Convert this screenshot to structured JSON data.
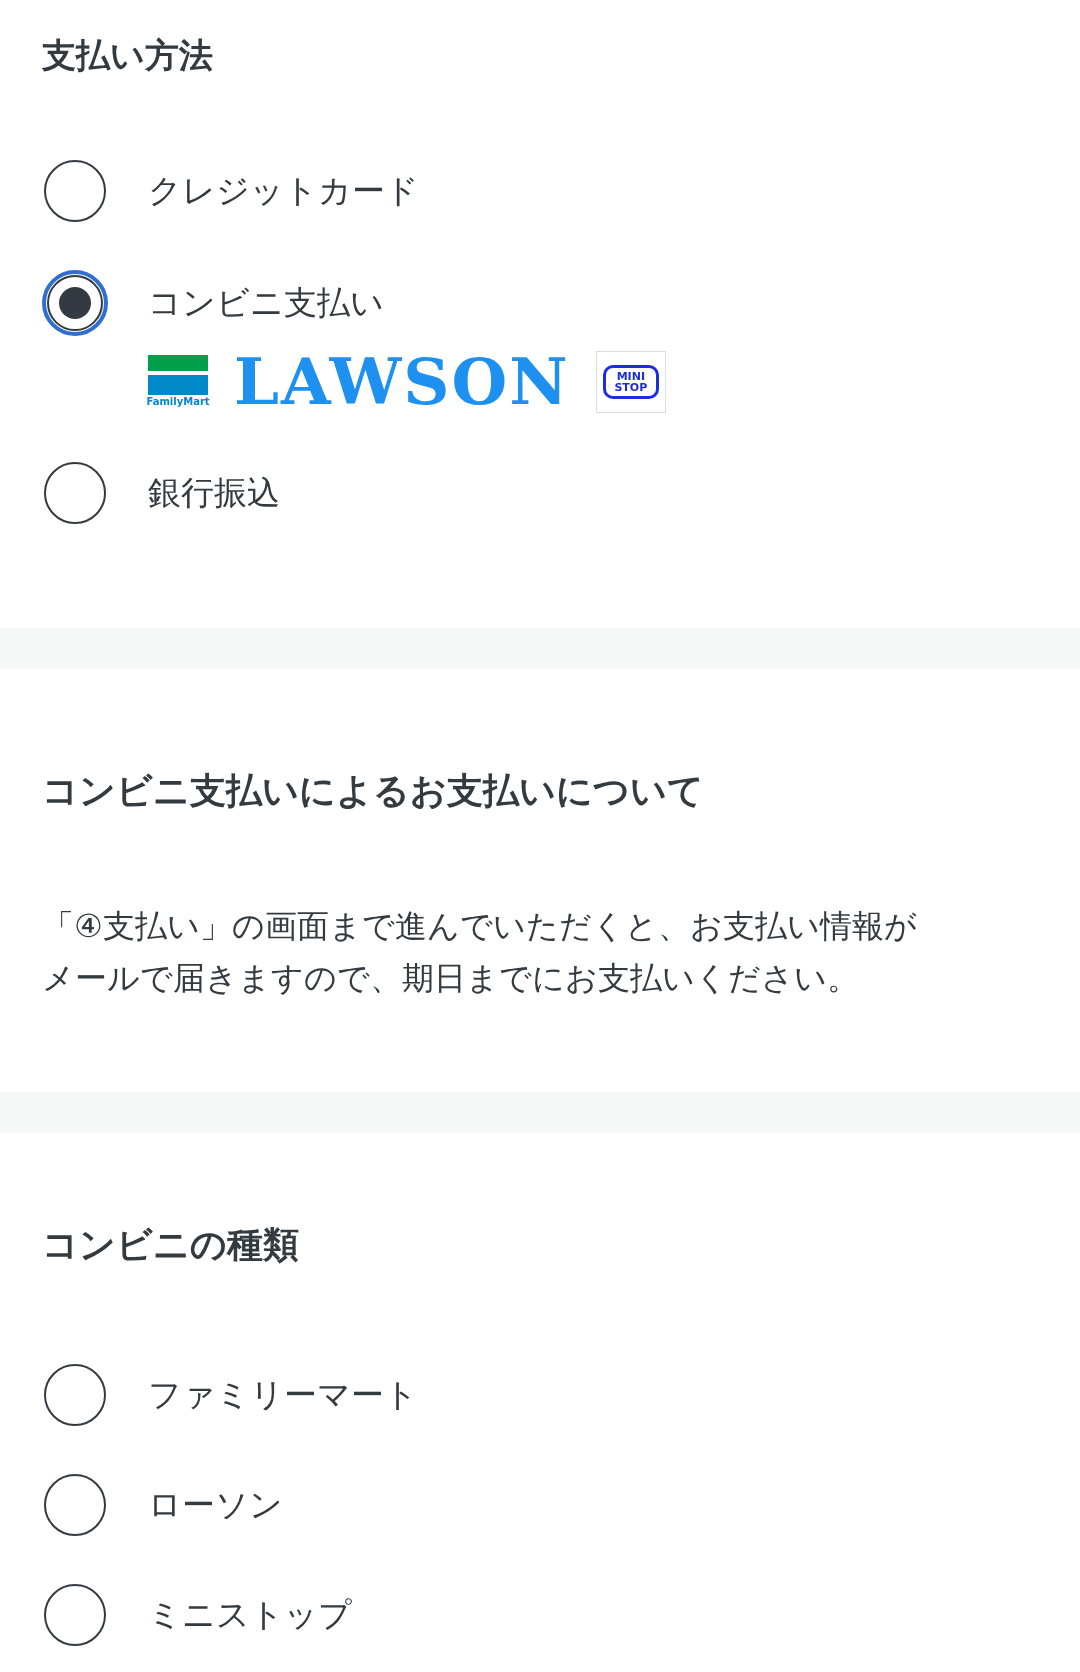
{
  "payment_method": {
    "title": "支払い方法",
    "options": [
      {
        "label": "クレジットカード",
        "selected": false
      },
      {
        "label": "コンビニ支払い",
        "selected": true,
        "logos": [
          {
            "kind": "familymart",
            "text": "FamilyMart"
          },
          {
            "kind": "lawson",
            "text": "LAWSON"
          },
          {
            "kind": "ministop",
            "text": "MINI STOP"
          }
        ]
      },
      {
        "label": "銀行振込",
        "selected": false
      }
    ]
  },
  "convenience_info": {
    "title": "コンビニ支払いによるお支払いについて",
    "body": "「④支払い」の画面まで進んでいただくと、お支払い情報がメールで届きますので、期日までにお支払いください。"
  },
  "store_type": {
    "title": "コンビニの種類",
    "options": [
      {
        "label": "ファミリーマート",
        "selected": false
      },
      {
        "label": "ローソン",
        "selected": false
      },
      {
        "label": "ミニストップ",
        "selected": false
      }
    ]
  }
}
